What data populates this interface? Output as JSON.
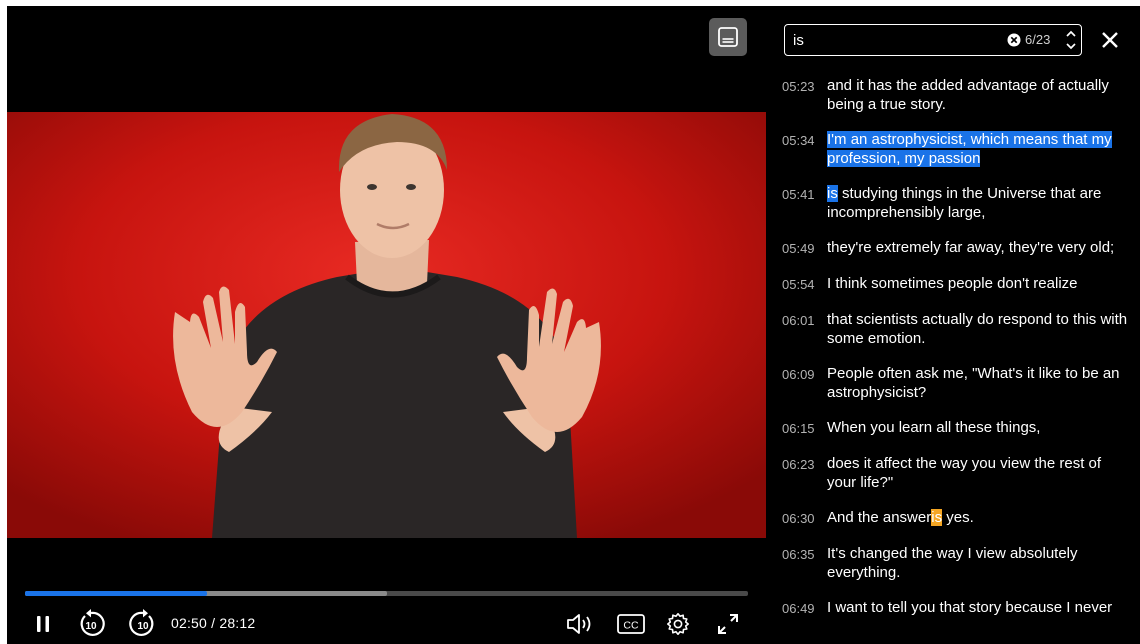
{
  "player": {
    "transcript_toggle_icon": "transcript-icon",
    "progress": {
      "played_fraction": 0.2515,
      "buffered_fraction": 0.5
    },
    "time": {
      "current": "02:50",
      "separator": " / ",
      "duration": "28:12"
    },
    "controls": {
      "pause_icon": "pause-icon",
      "rewind_icon": "rewind-10-icon",
      "rewind_seconds": "10",
      "forward_icon": "forward-10-icon",
      "forward_seconds": "10",
      "volume_icon": "volume-icon",
      "captions_icon": "captions-icon",
      "captions_label": "CC",
      "settings_icon": "settings-gear-icon",
      "fullscreen_icon": "fullscreen-icon"
    },
    "colors": {
      "progress_played": "#1a73e8",
      "progress_buffered": "#8a8a8a",
      "video_background": "#d0160f"
    }
  },
  "transcript": {
    "search": {
      "value": "is",
      "match_count": "6/23"
    },
    "close_icon": "close-icon",
    "clear_icon": "clear-search-icon",
    "prev_icon": "chevron-up-icon",
    "next_icon": "chevron-down-icon",
    "colors": {
      "current_match": "#1a73e8",
      "other_match": "#f5a623"
    },
    "cues": [
      {
        "time": "05:23",
        "segments": [
          {
            "t": "and it has the added advantage of actually being a true story.",
            "h": ""
          }
        ]
      },
      {
        "time": "05:34",
        "segments": [
          {
            "t": "I'm an astrophysicist, which means that my profession, my passion",
            "h": "current"
          }
        ]
      },
      {
        "time": "05:41",
        "segments": [
          {
            "t": "is",
            "h": "match"
          },
          {
            "t": " studying things in the Universe that are incomprehensibly large,",
            "h": ""
          }
        ]
      },
      {
        "time": "05:49",
        "segments": [
          {
            "t": "they're extremely far away, they're very old;",
            "h": ""
          }
        ]
      },
      {
        "time": "05:54",
        "segments": [
          {
            "t": "I think sometimes people don't realize",
            "h": ""
          }
        ]
      },
      {
        "time": "06:01",
        "segments": [
          {
            "t": "that scientists actually do respond to this with some emotion.",
            "h": ""
          }
        ]
      },
      {
        "time": "06:09",
        "segments": [
          {
            "t": "People often ask me, \"What's it like to be an astrophysicist?",
            "h": ""
          }
        ]
      },
      {
        "time": "06:15",
        "segments": [
          {
            "t": "When you learn all these things,",
            "h": ""
          }
        ]
      },
      {
        "time": "06:23",
        "segments": [
          {
            "t": "does it affect the way you view the rest of your life?\"",
            "h": ""
          }
        ]
      },
      {
        "time": "06:30",
        "segments": [
          {
            "t": "And the answer",
            "h": ""
          },
          {
            "t": "is",
            "h": "other"
          },
          {
            "t": " yes.",
            "h": ""
          }
        ]
      },
      {
        "time": "06:35",
        "segments": [
          {
            "t": "It's changed the way I view absolutely everything.",
            "h": ""
          }
        ]
      },
      {
        "time": "06:49",
        "segments": [
          {
            "t": "I want to tell you that story because I never",
            "h": ""
          }
        ]
      }
    ]
  }
}
